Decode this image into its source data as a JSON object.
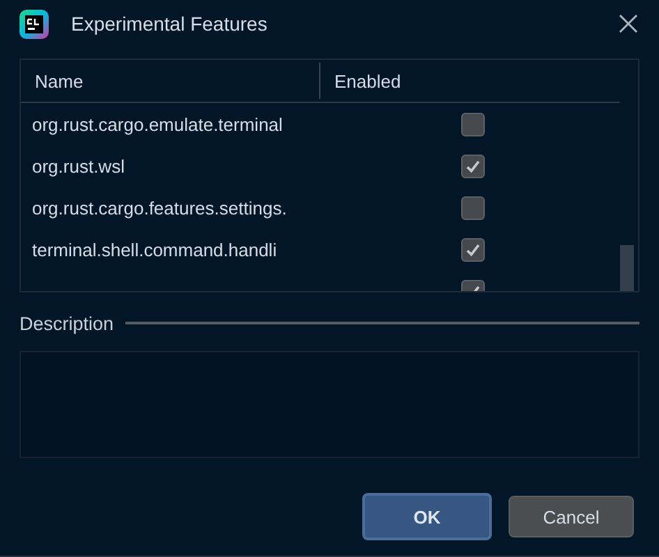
{
  "window": {
    "title": "Experimental Features"
  },
  "table": {
    "columns": [
      "Name",
      "Enabled"
    ],
    "rows": [
      {
        "name": "org.rust.cargo.emulate.terminal",
        "enabled": false
      },
      {
        "name": "org.rust.wsl",
        "enabled": true
      },
      {
        "name": "org.rust.cargo.features.settings.",
        "enabled": false
      },
      {
        "name": "terminal.shell.command.handli",
        "enabled": true
      },
      {
        "enabled": true
      }
    ]
  },
  "description": {
    "label": "Description"
  },
  "buttons": [
    {
      "label": "OK",
      "kind": "primary"
    },
    {
      "label": "Cancel",
      "kind": "secondary"
    }
  ]
}
